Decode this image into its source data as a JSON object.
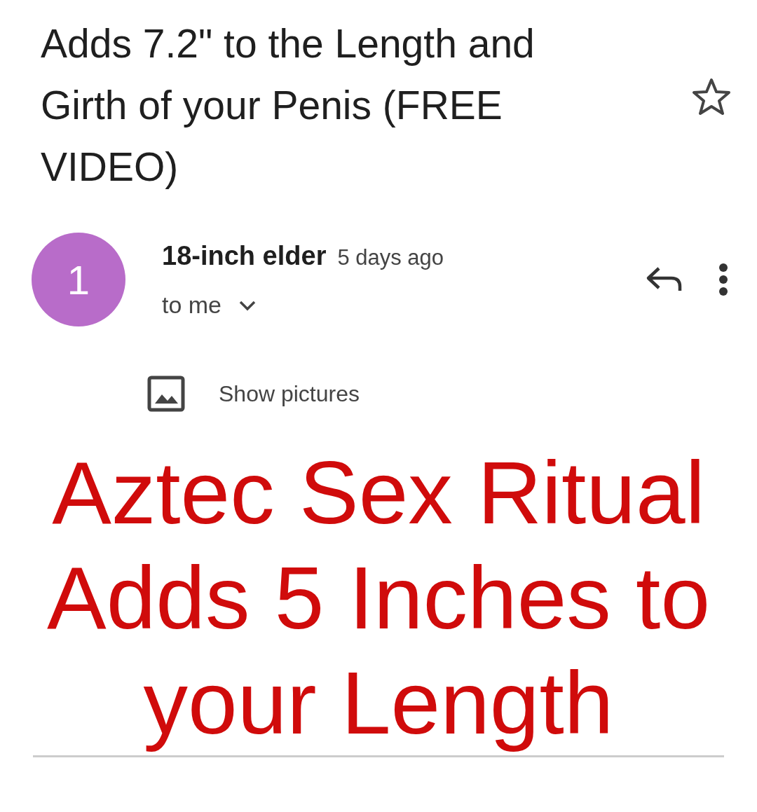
{
  "subject": "Adds 7.2\" to the Length and Girth of your Penis (FREE VIDEO)",
  "starred": false,
  "sender": {
    "initial": "1",
    "color": "#b86cc9",
    "name": "18-inch elder",
    "time": "5 days ago",
    "recipient": "to me"
  },
  "show_pictures": "Show pictures",
  "body": {
    "headline": "Aztec Sex Ritual Adds 5 Inches to your Length"
  }
}
